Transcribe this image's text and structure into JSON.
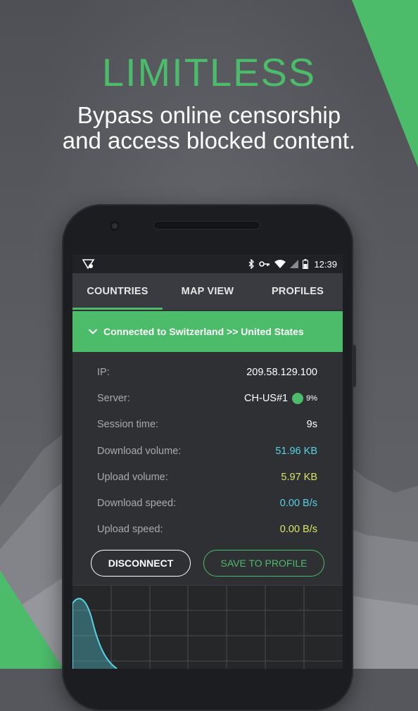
{
  "promo": {
    "headline": "LIMITLESS",
    "subline_1": "Bypass online censorship",
    "subline_2": "and access blocked content."
  },
  "colors": {
    "accent": "#4cbb6a",
    "cyan": "#57d2e2",
    "yellow": "#d8e56a"
  },
  "statusbar": {
    "icons": [
      "app-logo-icon",
      "bluetooth-icon",
      "vpn-key-icon",
      "wifi-icon",
      "signal-icon",
      "battery-icon"
    ],
    "time": "12:39"
  },
  "tabs": [
    {
      "label": "COUNTRIES",
      "active": true
    },
    {
      "label": "MAP VIEW",
      "active": false
    },
    {
      "label": "PROFILES",
      "active": false
    }
  ],
  "connection": {
    "status_text": "Connected to Switzerland >> United States"
  },
  "details": {
    "ip": {
      "label": "IP:",
      "value": "209.58.129.100"
    },
    "server": {
      "label": "Server:",
      "value": "CH-US#1",
      "load": "9%"
    },
    "session": {
      "label": "Session time:",
      "value": "9s"
    },
    "download_volume": {
      "label": "Download volume:",
      "value": "51.96 KB"
    },
    "upload_volume": {
      "label": "Upload volume:",
      "value": "5.97 KB"
    },
    "download_speed": {
      "label": "Download speed:",
      "value": "0.00 B/s"
    },
    "upload_speed": {
      "label": "Upload speed:",
      "value": "0.00 B/s"
    }
  },
  "buttons": {
    "disconnect": "DISCONNECT",
    "save": "SAVE TO PROFILE"
  }
}
